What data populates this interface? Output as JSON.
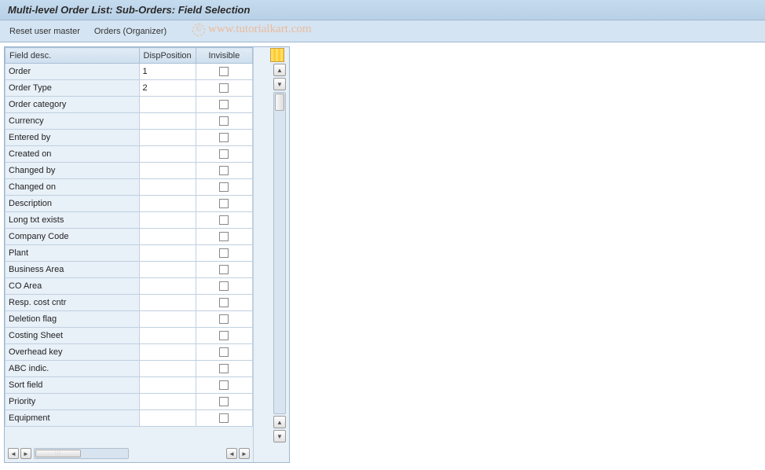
{
  "header": {
    "title": "Multi-level Order List: Sub-Orders: Field Selection"
  },
  "toolbar": {
    "reset_label": "Reset user master",
    "orders_label": "Orders (Organizer)"
  },
  "watermark": {
    "copyright": "©",
    "text": "www.tutorialkart.com"
  },
  "table": {
    "columns": {
      "field_desc": "Field desc.",
      "disp_position": "DispPosition",
      "invisible": "Invisible"
    },
    "rows": [
      {
        "field": "Order",
        "disp": "1",
        "inv": false
      },
      {
        "field": "Order Type",
        "disp": "2",
        "inv": false
      },
      {
        "field": "Order category",
        "disp": "",
        "inv": false
      },
      {
        "field": "Currency",
        "disp": "",
        "inv": false
      },
      {
        "field": "Entered by",
        "disp": "",
        "inv": false
      },
      {
        "field": "Created on",
        "disp": "",
        "inv": false
      },
      {
        "field": "Changed by",
        "disp": "",
        "inv": false
      },
      {
        "field": "Changed on",
        "disp": "",
        "inv": false
      },
      {
        "field": "Description",
        "disp": "",
        "inv": false
      },
      {
        "field": "Long txt exists",
        "disp": "",
        "inv": false
      },
      {
        "field": "Company Code",
        "disp": "",
        "inv": false
      },
      {
        "field": "Plant",
        "disp": "",
        "inv": false
      },
      {
        "field": "Business Area",
        "disp": "",
        "inv": false
      },
      {
        "field": "CO Area",
        "disp": "",
        "inv": false
      },
      {
        "field": "Resp. cost cntr",
        "disp": "",
        "inv": false
      },
      {
        "field": "Deletion flag",
        "disp": "",
        "inv": false
      },
      {
        "field": "Costing Sheet",
        "disp": "",
        "inv": false
      },
      {
        "field": "Overhead key",
        "disp": "",
        "inv": false
      },
      {
        "field": "ABC indic.",
        "disp": "",
        "inv": false
      },
      {
        "field": "Sort field",
        "disp": "",
        "inv": false
      },
      {
        "field": "Priority",
        "disp": "",
        "inv": false
      },
      {
        "field": "Equipment",
        "disp": "",
        "inv": false
      }
    ]
  }
}
